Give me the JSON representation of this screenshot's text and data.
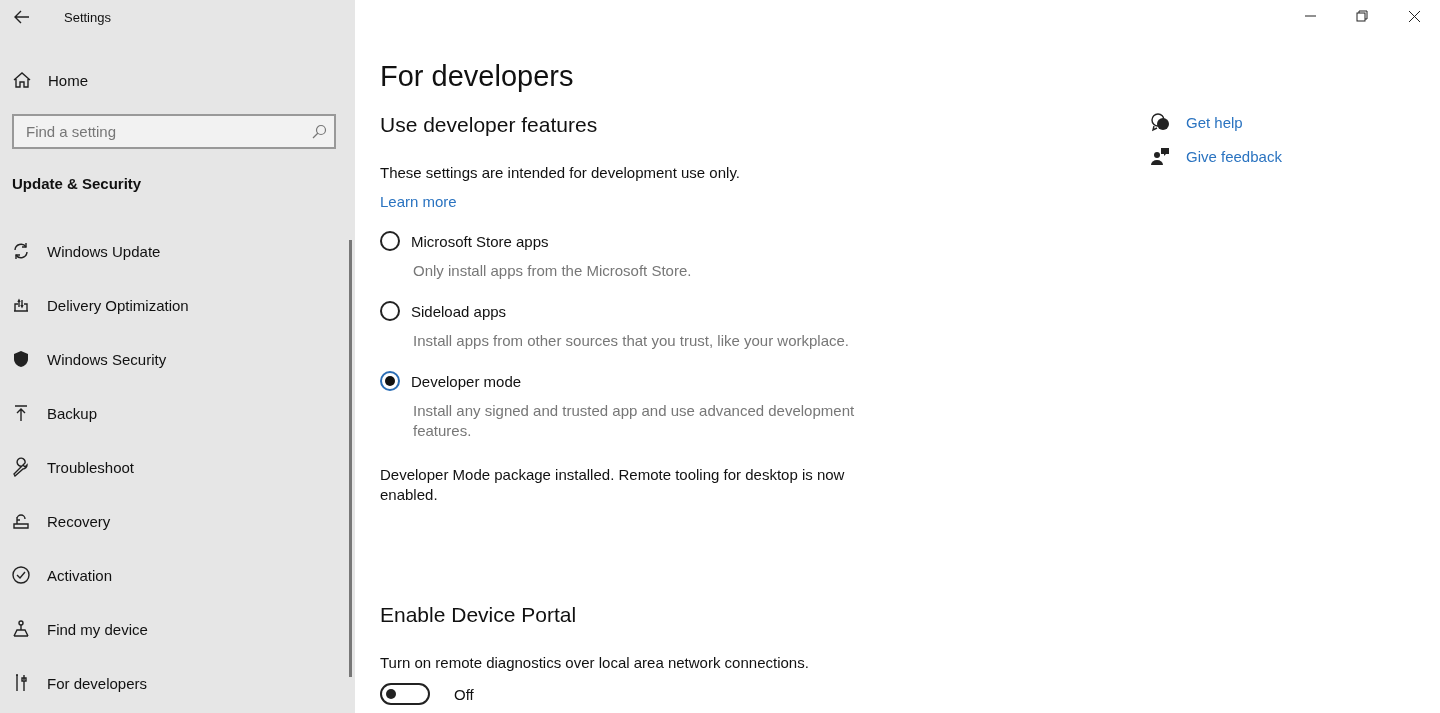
{
  "window": {
    "title": "Settings"
  },
  "sidebar": {
    "home": "Home",
    "search": {
      "placeholder": "Find a setting"
    },
    "section": "Update & Security",
    "items": [
      {
        "label": "Windows Update",
        "kind": "sync"
      },
      {
        "label": "Delivery Optimization",
        "kind": "delivery"
      },
      {
        "label": "Windows Security",
        "kind": "shield"
      },
      {
        "label": "Backup",
        "kind": "backup"
      },
      {
        "label": "Troubleshoot",
        "kind": "wrench"
      },
      {
        "label": "Recovery",
        "kind": "recovery"
      },
      {
        "label": "Activation",
        "kind": "check"
      },
      {
        "label": "Find my device",
        "kind": "person"
      },
      {
        "label": "For developers",
        "kind": "tools"
      }
    ]
  },
  "content": {
    "title": "For developers",
    "heading": "Use developer features",
    "intro": "These settings are intended for development use only.",
    "learn_more": "Learn more",
    "options": [
      {
        "label": "Microsoft Store apps",
        "description": "Only install apps from the Microsoft Store.",
        "selected": false
      },
      {
        "label": "Sideload apps",
        "description": "Install apps from other sources that you trust, like your workplace.",
        "selected": false
      },
      {
        "label": "Developer mode",
        "description": "Install any signed and trusted app and use advanced development features.",
        "selected": true
      }
    ],
    "status": "Developer Mode package installed.  Remote tooling for desktop is now enabled.",
    "portal": {
      "heading": "Enable Device Portal",
      "description": "Turn on remote diagnostics over local area network connections.",
      "toggle": {
        "on": false,
        "label": "Off"
      }
    }
  },
  "links": [
    {
      "label": "Get help",
      "kind": "help"
    },
    {
      "label": "Give feedback",
      "kind": "feedback"
    }
  ]
}
